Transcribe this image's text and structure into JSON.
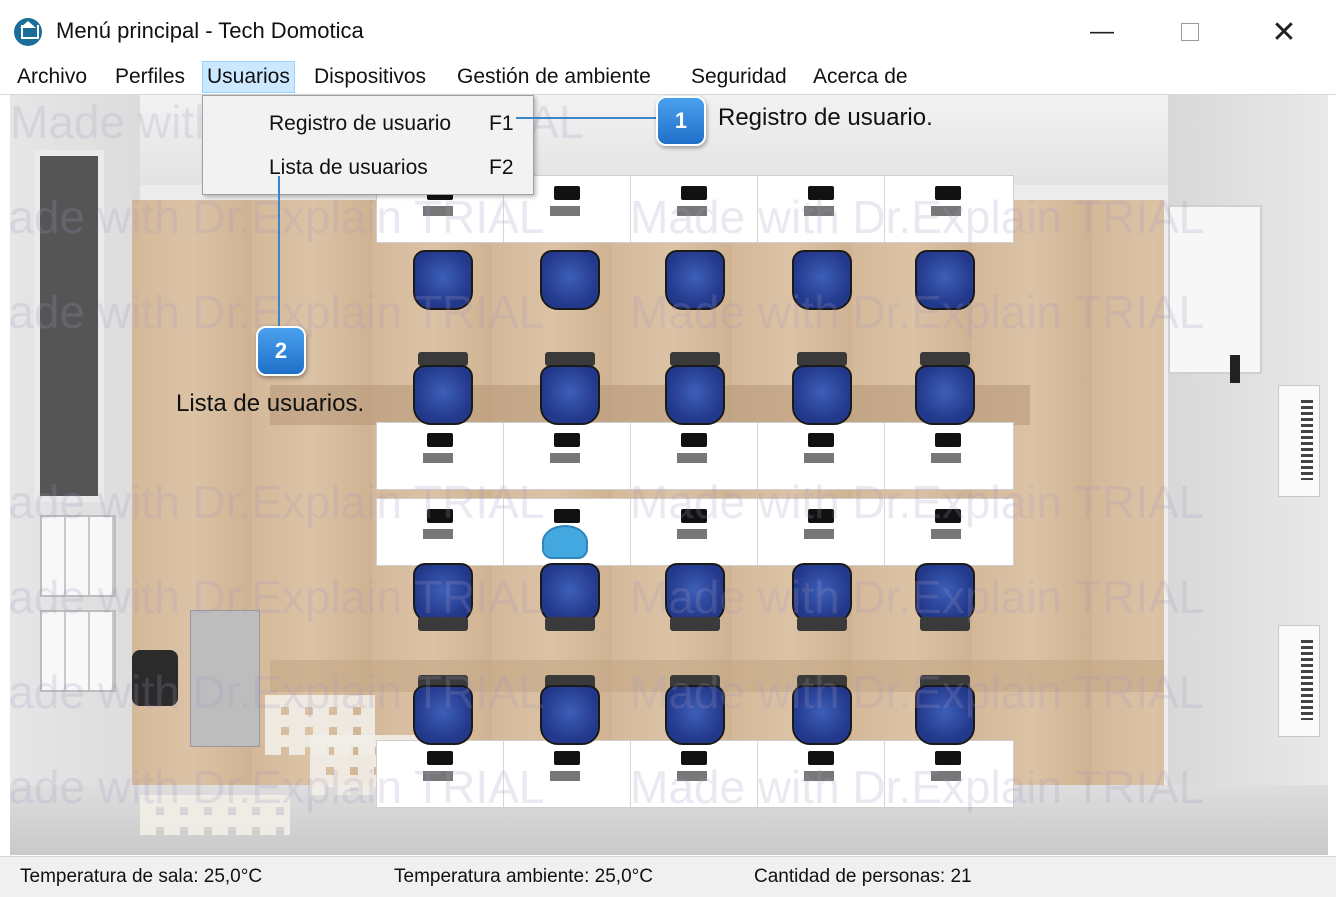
{
  "window": {
    "title": "Menú principal - Tech Domotica",
    "minimize_symbol": "—",
    "close_symbol": "✕"
  },
  "menubar": {
    "items": [
      "Archivo",
      "Perfiles",
      "Usuarios",
      "Dispositivos",
      "Gestión de ambiente",
      "Seguridad",
      "Acerca de"
    ],
    "active": "Usuarios"
  },
  "dropdown": {
    "items": [
      {
        "label": "Registro de usuario",
        "shortcut": "F1"
      },
      {
        "label": "Lista de usuarios",
        "shortcut": "F2"
      }
    ]
  },
  "callouts": [
    {
      "number": "1",
      "text": "Registro de usuario."
    },
    {
      "number": "2",
      "text": "Lista de usuarios."
    }
  ],
  "watermark": {
    "text": "Made with Dr.Explain TRIAL"
  },
  "statusbar": {
    "room_temperature": "Temperatura de sala: 25,0°C",
    "ambient_temperature": "Temperatura ambiente: 25,0°C",
    "people_count": "Cantidad de personas: 21"
  },
  "icons": {
    "app": "house-icon",
    "person": "person-icon"
  },
  "colors": {
    "callout": "#2a7fd6",
    "menu_active": "#cce8ff",
    "chair": "#2d4aa3"
  }
}
